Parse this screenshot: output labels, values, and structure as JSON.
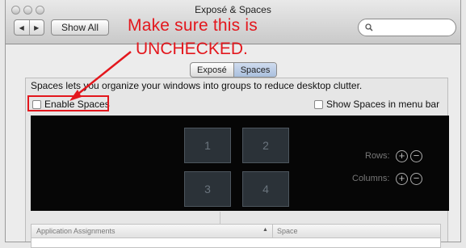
{
  "window": {
    "title": "Exposé & Spaces"
  },
  "toolbar": {
    "back_glyph": "◀",
    "forward_glyph": "▶",
    "show_all_label": "Show All"
  },
  "search": {
    "value": "",
    "icon": "magnifier-icon"
  },
  "annotation": {
    "line1": "Make sure this is",
    "line2": "UNCHECKED.",
    "color": "#e3171d"
  },
  "tabs": [
    {
      "label": "Exposé",
      "selected": false
    },
    {
      "label": "Spaces",
      "selected": true
    }
  ],
  "description": "Spaces lets you organize your windows into groups to reduce desktop clutter.",
  "enable_spaces": {
    "label": "Enable Spaces",
    "checked": false
  },
  "show_in_menubar": {
    "label": "Show Spaces in menu bar",
    "checked": false
  },
  "spaces_grid": {
    "tiles": [
      "1",
      "2",
      "3",
      "4"
    ]
  },
  "rows": {
    "label": "Rows:",
    "add_glyph": "+",
    "remove_glyph": "−"
  },
  "columns": {
    "label": "Columns:",
    "add_glyph": "+",
    "remove_glyph": "−"
  },
  "assignments": {
    "col1": "Application Assignments",
    "sort_glyph": "▲",
    "col2": "Space"
  },
  "colors": {
    "selected_tab": "#b6c8e4",
    "preview_bg": "#060606"
  }
}
